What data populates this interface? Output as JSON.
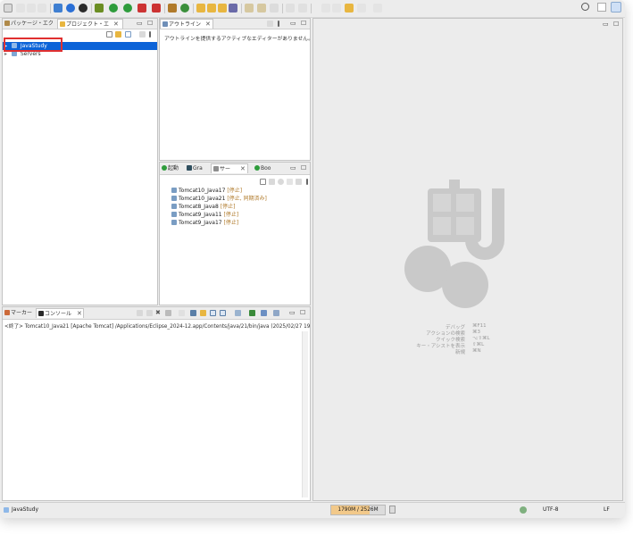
{
  "toolbar": {
    "search_icon": "search-icon"
  },
  "left_panel": {
    "tab_package_explorer": "パッケージ・エク",
    "tab_project_explorer": "プロジェクト・エ",
    "tree": [
      {
        "label": "JavaStudy"
      },
      {
        "label": "Servers"
      }
    ]
  },
  "outline": {
    "tab_label": "アウトライン",
    "message": "アウトラインを提供するアクティブなエディターがありません。"
  },
  "servers_panel": {
    "tabs": [
      {
        "label": "起動"
      },
      {
        "label": "Gra"
      },
      {
        "label": "サー"
      },
      {
        "label": "Boo"
      }
    ],
    "servers": [
      {
        "name": "Tomcat10_Java17",
        "status": "[停止]"
      },
      {
        "name": "Tomcat10_Java21",
        "status": "[停止, 同期済み]"
      },
      {
        "name": "Tomcat8_Java8",
        "status": "[停止]"
      },
      {
        "name": "Tomcat9_Java11",
        "status": "[停止]"
      },
      {
        "name": "Tomcat9_Java17",
        "status": "[停止]"
      }
    ]
  },
  "console": {
    "tab_markers": "マーカー",
    "tab_console": "コンソール",
    "terminated_line": "<終了> Tomcat10_Java21 [Apache Tomcat] /Applications/Eclipse_2024-12.app/Contents/java/21/bin/java  (2025/02/27 19"
  },
  "editor_hints": [
    {
      "label": "デバッグ",
      "key": "⌘F11"
    },
    {
      "label": "アクションの検索",
      "key": "⌘3"
    },
    {
      "label": "クイック検索",
      "key": "⌥⇧⌘L"
    },
    {
      "label": "キー・アシストを表示",
      "key": "⇧⌘L"
    },
    {
      "label": "新規",
      "key": "⌘N"
    }
  ],
  "status_bar": {
    "project": "JavaStudy",
    "heap": "1790M / 2526M",
    "heap_fraction": 0.709,
    "encoding": "UTF-8",
    "line_ending": "LF"
  },
  "colors": {
    "selection": "#0c63d8",
    "highlight_box": "#e03030",
    "brand_gray": "#c9c9c9"
  }
}
